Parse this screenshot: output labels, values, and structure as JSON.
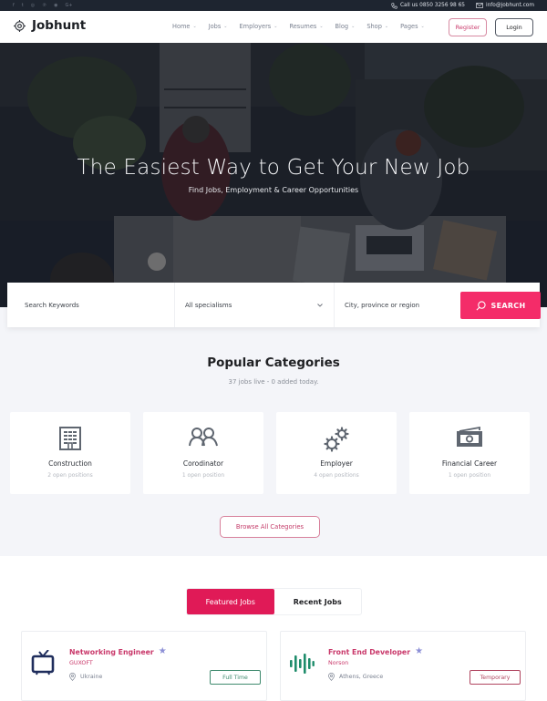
{
  "topbar": {
    "social_icons": [
      "facebook-icon",
      "twitter-icon",
      "instagram-icon",
      "pinterest-icon",
      "dribbble-icon",
      "google-plus-icon"
    ],
    "social_glyphs": [
      "f",
      "t",
      "◎",
      "℗",
      "◉",
      "G+"
    ],
    "phone_text": "Call us 0850 3256 98 65",
    "email_text": "info@jobhunt.com"
  },
  "header": {
    "logo_text": "Jobhunt",
    "nav": [
      {
        "label": "Home"
      },
      {
        "label": "Jobs"
      },
      {
        "label": "Employers"
      },
      {
        "label": "Resumes"
      },
      {
        "label": "Blog"
      },
      {
        "label": "Shop"
      },
      {
        "label": "Pages"
      }
    ],
    "register_label": "Register",
    "login_label": "Login"
  },
  "hero": {
    "title": "The Easiest Way to Get Your New Job",
    "subtitle": "Find Jobs, Employment & Career Opportunities"
  },
  "search": {
    "keywords_placeholder": "Search Keywords",
    "specialism_value": "All specialisms",
    "location_placeholder": "City, province or region",
    "button_label": "SEARCH"
  },
  "categories": {
    "title": "Popular Categories",
    "subtitle": "37 jobs live - 0 added today.",
    "items": [
      {
        "label": "Construction",
        "count": "2 open positions",
        "icon": "building-icon"
      },
      {
        "label": "Corodinator",
        "count": "1 open position",
        "icon": "users-icon"
      },
      {
        "label": "Employer",
        "count": "4 open positions",
        "icon": "gears-icon"
      },
      {
        "label": "Financial Career",
        "count": "1 open position",
        "icon": "money-icon"
      }
    ],
    "browse_label": "Browse All Categories"
  },
  "jobs": {
    "tabs": [
      {
        "label": "Featured Jobs",
        "active": true
      },
      {
        "label": "Recent Jobs",
        "active": false
      }
    ],
    "items": [
      {
        "title": "Networking Engineer",
        "company": "GUXOFT",
        "location": "Ukraine",
        "type": "Full Time",
        "type_color": "#3f8a6e",
        "logo": "tv-icon",
        "logo_color": "#1f2d5c"
      },
      {
        "title": "Front End Developer",
        "company": "Norson",
        "location": "Athens, Greece",
        "type": "Temporary",
        "type_color": "#b0455f",
        "logo": "soundwave-icon",
        "logo_color": "#1e8c6b"
      }
    ]
  },
  "colors": {
    "accent": "#f42c69",
    "accent_dark": "#e01a57",
    "topbar_bg": "#1e2530",
    "section_bg": "#f4f5f9"
  }
}
